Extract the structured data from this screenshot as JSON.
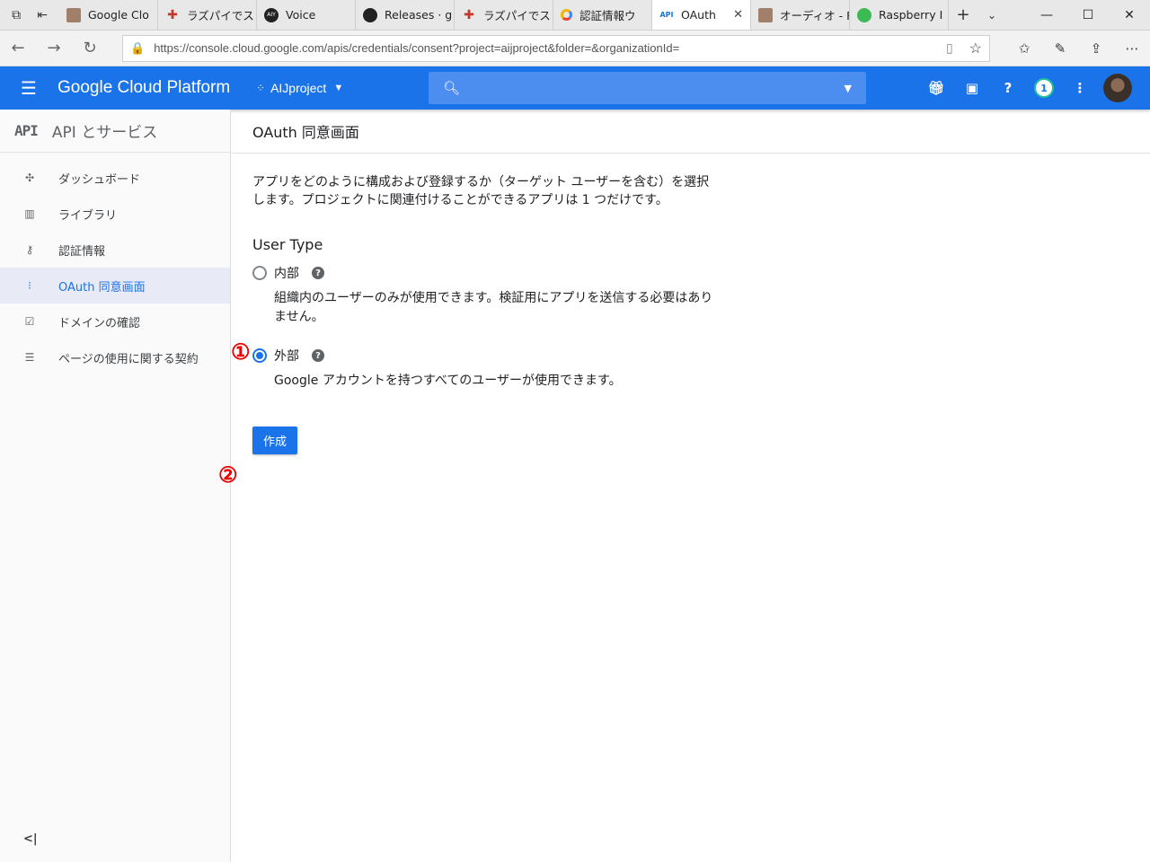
{
  "browser": {
    "tabs": [
      {
        "label": "Google Clo",
        "icon": "avatar-favicon"
      },
      {
        "label": "ラズパイでス",
        "icon": "plus-cross-favicon"
      },
      {
        "label": "Voice",
        "icon": "aiy-favicon"
      },
      {
        "label": "Releases · g",
        "icon": "github-favicon"
      },
      {
        "label": "ラズパイでス",
        "icon": "plus-cross-favicon"
      },
      {
        "label": "認証情報ウ",
        "icon": "gcp-favicon"
      },
      {
        "label": "OAuth",
        "icon": "api-favicon",
        "active": true
      },
      {
        "label": "オーディオ - F",
        "icon": "avatar-favicon"
      },
      {
        "label": "Raspberry I",
        "icon": "raspberry-favicon"
      }
    ],
    "url": "https://console.cloud.google.com/apis/credentials/consent?project=aijproject&folder=&organizationId="
  },
  "header": {
    "brand": "Google Cloud Platform",
    "project": "AIJproject",
    "notification_count": "1"
  },
  "sidebar": {
    "title": "API とサービス",
    "logo": "API",
    "items": [
      {
        "label": "ダッシュボード",
        "icon": "dashboard-icon"
      },
      {
        "label": "ライブラリ",
        "icon": "library-icon"
      },
      {
        "label": "認証情報",
        "icon": "key-icon"
      },
      {
        "label": "OAuth 同意画面",
        "icon": "consent-icon",
        "active": true
      },
      {
        "label": "ドメインの確認",
        "icon": "domain-check-icon"
      },
      {
        "label": "ページの使用に関する契約",
        "icon": "page-settings-icon"
      }
    ]
  },
  "main": {
    "title": "OAuth 同意画面",
    "intro": "アプリをどのように構成および登録するか（ターゲット ユーザーを含む）を選択します。プロジェクトに関連付けることができるアプリは 1 つだけです。",
    "user_type_heading": "User Type",
    "options": [
      {
        "label": "内部",
        "description": "組織内のユーザーのみが使用できます。検証用にアプリを送信する必要はありません。",
        "selected": false
      },
      {
        "label": "外部",
        "description": "Google アカウントを持つすべてのユーザーが使用できます。",
        "selected": true
      }
    ],
    "create_button": "作成"
  },
  "annotations": {
    "step1": "①",
    "step2": "②",
    "color": "#e00000"
  },
  "colors": {
    "header_blue": "#1a73e8",
    "active_item_bg": "#e8eaf6"
  }
}
